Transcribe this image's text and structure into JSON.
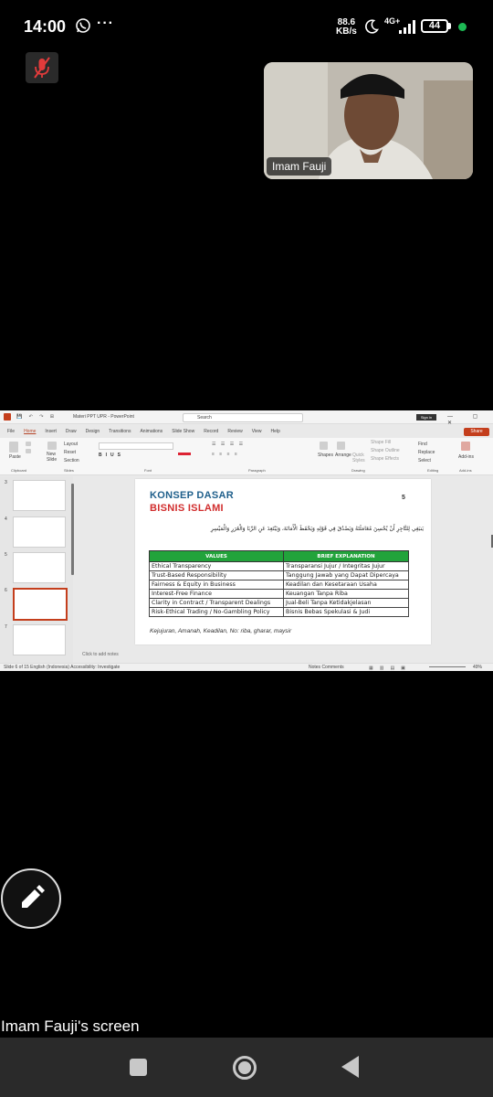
{
  "status_bar": {
    "time": "14:00",
    "more": "···",
    "net_speed_value": "88.6",
    "net_speed_unit": "KB/s",
    "net_type": "4G+",
    "battery": "44"
  },
  "participant": {
    "name": "Imam Fauji"
  },
  "shared_screen": {
    "owner_label": "Imam Fauji's screen",
    "app": {
      "title": "Materi PPT UPR - PowerPoint",
      "search_placeholder": "Search",
      "signin": "Sign in",
      "window_controls": "— ▢ ✕",
      "share_label": "Share",
      "tabs": [
        {
          "label": "File"
        },
        {
          "label": "Home"
        },
        {
          "label": "Insert"
        },
        {
          "label": "Draw"
        },
        {
          "label": "Design"
        },
        {
          "label": "Transitions"
        },
        {
          "label": "Animations"
        },
        {
          "label": "Slide Show"
        },
        {
          "label": "Record"
        },
        {
          "label": "Review"
        },
        {
          "label": "View"
        },
        {
          "label": "Help"
        }
      ],
      "ribbon_groups": {
        "clipboard": "Clipboard",
        "slides": "Slides",
        "font": "Font",
        "paragraph": "Paragraph",
        "drawing": "Drawing",
        "editing": "Editing",
        "addins": "Add-ins"
      },
      "ribbon_items": {
        "paste": "Paste",
        "new_slide": "New Slide",
        "layout": "Layout",
        "reset": "Reset",
        "section": "Section",
        "shapes": "Shapes",
        "arrange": "Arrange",
        "quick_styles": "Quick Styles",
        "shape_fill": "Shape Fill",
        "shape_outline": "Shape Outline",
        "shape_effects": "Shape Effects",
        "find": "Find",
        "replace": "Replace",
        "select": "Select",
        "addins_btn": "Add-ins"
      },
      "thumbnail_numbers": [
        "3",
        "4",
        "5",
        "6",
        "7"
      ],
      "notes_placeholder": "Click to add notes",
      "status_left": "Slide 6 of 15    English (Indonesia)    Accessibility: Investigate",
      "status_right": "Notes    Comments",
      "zoom": "49%"
    },
    "slide": {
      "title_line1": "KONSEP DASAR",
      "title_line2": "BISNIS ISLAMI",
      "number": "5",
      "arabic_text": "يَنبَغِي لِلتَّاجِرِ أَنْ يُحْسِنَ مُعَامَلَتَهُ وَيَصْدُقَ فِي قَوْلِهِ وَيَحْفَظَ الْأَمَانَةَ، وَيَبْتَعِدَ عَنِ الرِّبَا وَالْغَرَرِ وَالْمَيْسِرِ",
      "table": {
        "headers": [
          "VALUES",
          "BRIEF EXPLANATION"
        ],
        "rows": [
          [
            "Ethical Transparency",
            "Transparansi Jujur / Integritas Jujur"
          ],
          [
            "Trust-Based Responsibility",
            "Tanggung Jawab yang Dapat Dipercaya"
          ],
          [
            "Fairness & Equity in Business",
            "Keadilan dan Kesetaraan Usaha"
          ],
          [
            "Interest-Free Finance",
            "Keuangan Tanpa Riba"
          ],
          [
            "Clarity in Contract / Transparent Dealings",
            "Jual-Beli Tanpa Ketidakjelasan"
          ],
          [
            "Risk-Ethical Trading / No-Gambling Policy",
            "Bisnis Bebas Spekulasi & Judi"
          ]
        ]
      },
      "footnote": "Kejujuran, Amanah, Keadilan, No: riba, gharar, maysir"
    }
  },
  "colors": {
    "slide_title_blue": "#1f5f8b",
    "slide_title_red": "#d12d2d",
    "table_header_green": "#22a33b",
    "ppt_accent": "#c43e1c",
    "status_dot": "#1db954"
  },
  "icons": [
    "whatsapp-icon",
    "moon-icon",
    "signal-icon",
    "battery-icon",
    "mic-off-icon",
    "pencil-icon",
    "nav-recents-icon",
    "nav-home-icon",
    "nav-back-icon"
  ]
}
